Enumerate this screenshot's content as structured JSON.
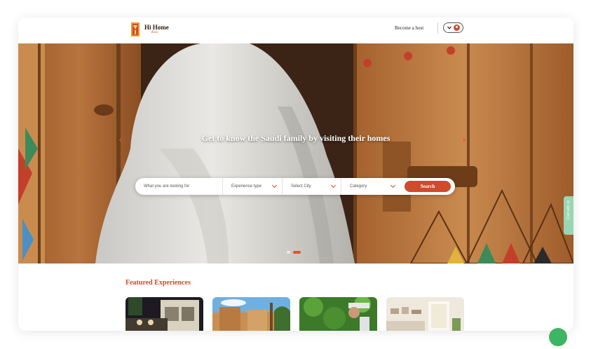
{
  "header": {
    "logo_text": "Hi Home",
    "logo_sub": "Ksa",
    "become_host": "Become a host"
  },
  "hero": {
    "title": "Get to know the Saudi family by visiting their homes",
    "prev_arrow": "‹",
    "next_arrow": "›",
    "slides_count": 2,
    "active_slide": 2
  },
  "search": {
    "query_placeholder": "What you are looking for",
    "experience_type": "Experience type",
    "city": "Select City",
    "category": "Category",
    "button_label": "Search"
  },
  "chat_tab": {
    "label": "Chat with us"
  },
  "featured": {
    "title": "Featured Experiences",
    "items": [
      {
        "thumb": "night-dining"
      },
      {
        "thumb": "mud-village"
      },
      {
        "thumb": "orchard-man"
      },
      {
        "thumb": "living-room"
      }
    ]
  },
  "colors": {
    "accent": "#cf4b2b",
    "chat": "#9ad6b4",
    "whatsapp": "#3fb463"
  },
  "icons": {
    "chevron": "chevron-down-icon",
    "account": "user-icon",
    "chat": "whatsapp-icon"
  }
}
